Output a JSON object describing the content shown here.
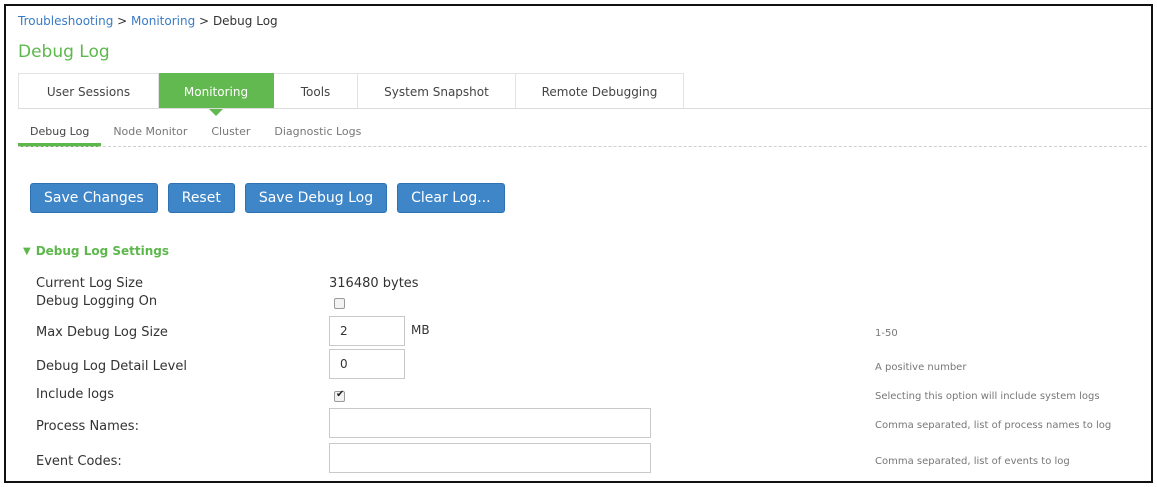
{
  "breadcrumb": {
    "items": [
      "Troubleshooting",
      "Monitoring",
      "Debug Log"
    ],
    "separator": ">"
  },
  "page": {
    "title": "Debug Log"
  },
  "tabs": [
    {
      "label": "User Sessions",
      "active": false
    },
    {
      "label": "Monitoring",
      "active": true
    },
    {
      "label": "Tools",
      "active": false
    },
    {
      "label": "System Snapshot",
      "active": false
    },
    {
      "label": "Remote Debugging",
      "active": false
    }
  ],
  "subtabs": [
    {
      "label": "Debug Log",
      "active": true
    },
    {
      "label": "Node Monitor",
      "active": false
    },
    {
      "label": "Cluster",
      "active": false
    },
    {
      "label": "Diagnostic Logs",
      "active": false
    }
  ],
  "buttons": {
    "save_changes": "Save Changes",
    "reset": "Reset",
    "save_debug_log": "Save Debug Log",
    "clear_log": "Clear Log..."
  },
  "settings": {
    "header": "Debug Log Settings",
    "current_log_size": {
      "label": "Current Log Size",
      "value": "316480  bytes"
    },
    "debug_logging_on": {
      "label": "Debug Logging On",
      "checked": false
    },
    "max_debug_log_size": {
      "label": "Max Debug Log Size",
      "value": "2",
      "unit": "MB",
      "hint": "1-50"
    },
    "detail_level": {
      "label": "Debug Log Detail Level",
      "value": "0",
      "hint": "A positive number"
    },
    "include_logs": {
      "label": "Include logs",
      "checked": true,
      "hint": "Selecting this option will include system logs"
    },
    "process_names": {
      "label": "Process Names:",
      "value": "",
      "hint": "Comma separated, list of process names to log"
    },
    "event_codes": {
      "label": "Event Codes:",
      "value": "",
      "hint": "Comma separated, list of events to log"
    }
  },
  "colors": {
    "accent_green": "#5db84c",
    "active_tab_green": "#62b94f",
    "button_blue": "#3f86c9",
    "link_blue": "#3a7cc4"
  }
}
